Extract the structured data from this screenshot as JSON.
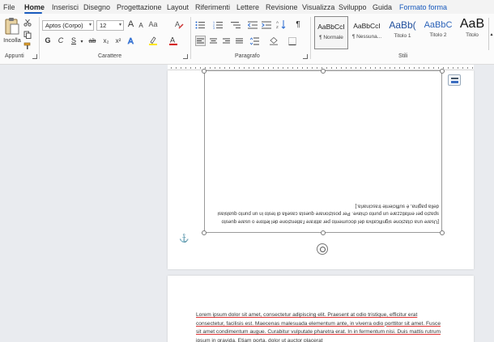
{
  "menu": {
    "tabs": [
      "File",
      "Home",
      "Inserisci",
      "Disegno",
      "Progettazione",
      "Layout",
      "Riferimenti",
      "Lettere",
      "Revisione",
      "Visualizza",
      "Sviluppo",
      "Guida",
      "Formato forma"
    ]
  },
  "ribbon": {
    "appunti": {
      "paste_label": "Incolla",
      "group_label": "Appunti"
    },
    "carattere": {
      "font_name": "Aptos (Corpo)",
      "font_size": "12",
      "bold": "G",
      "italic": "C",
      "underline": "S",
      "strike": "ab",
      "subscript": "x₂",
      "superscript": "x²",
      "grow": "A",
      "shrink": "A",
      "group_label": "Carattere"
    },
    "paragrafo": {
      "group_label": "Paragrafo",
      "show_marks": "¶"
    },
    "stili": {
      "group_label": "Stili",
      "items": [
        {
          "sample": "AaBbCcI",
          "name": "¶ Normale"
        },
        {
          "sample": "AaBbCcI",
          "name": "¶ Nessuna..."
        },
        {
          "sample": "AaBb(",
          "name": "Titolo 1"
        },
        {
          "sample": "AaBbC",
          "name": "Titolo 2"
        },
        {
          "sample": "AaB",
          "name": "Titolo"
        }
      ]
    }
  },
  "document": {
    "textbox_text": "[Usare una citazione significativa del documento per attirare l'attenzione del lettore o usare questo spazio per enfatizzare un punto chiave. Per posizionare questa casella di testo in un punto qualsiasi della pagina, è sufficiente trascinarla.]",
    "lorem_text": "Lorem ipsum dolor sit amet, consectetur adipiscing elit. Praesent at odio tristique, efficitur erat consectetur, facilisis est. Maecenas malesuada elementum ante, in viverra odio porttitor sit amet. Fusce sit amet condimentum augue. Curabitur vulputate pharetra erat. In in fermentum nisi. Duis mattis rutrum ipsum in gravida. Etiam porta, dolor ut auctor placerat"
  },
  "colors": {
    "accent": "#185abd",
    "highlight": "#ffe600",
    "font_color": "#d40000"
  }
}
